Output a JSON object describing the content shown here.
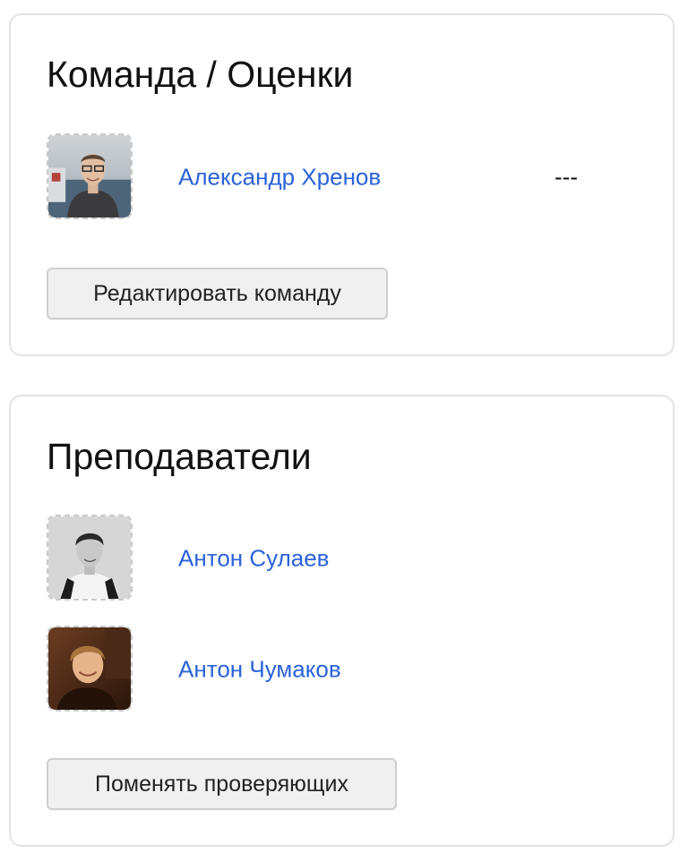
{
  "team_card": {
    "title": "Команда / Оценки",
    "members": [
      {
        "name": "Александр Хренов",
        "score": "---",
        "avatar_icon": "user-photo-icon"
      }
    ],
    "edit_button_label": "Редактировать команду"
  },
  "teachers_card": {
    "title": "Преподаватели",
    "members": [
      {
        "name": "Антон Сулаев",
        "avatar_icon": "user-photo-icon"
      },
      {
        "name": "Антон Чумаков",
        "avatar_icon": "user-photo-icon"
      }
    ],
    "change_button_label": "Поменять проверяющих"
  },
  "colors": {
    "link": "#2a62d9",
    "card_border": "#e3e3e3",
    "button_bg": "#f0f0f0",
    "avatar_dashed_border": "#c9c9c9"
  }
}
